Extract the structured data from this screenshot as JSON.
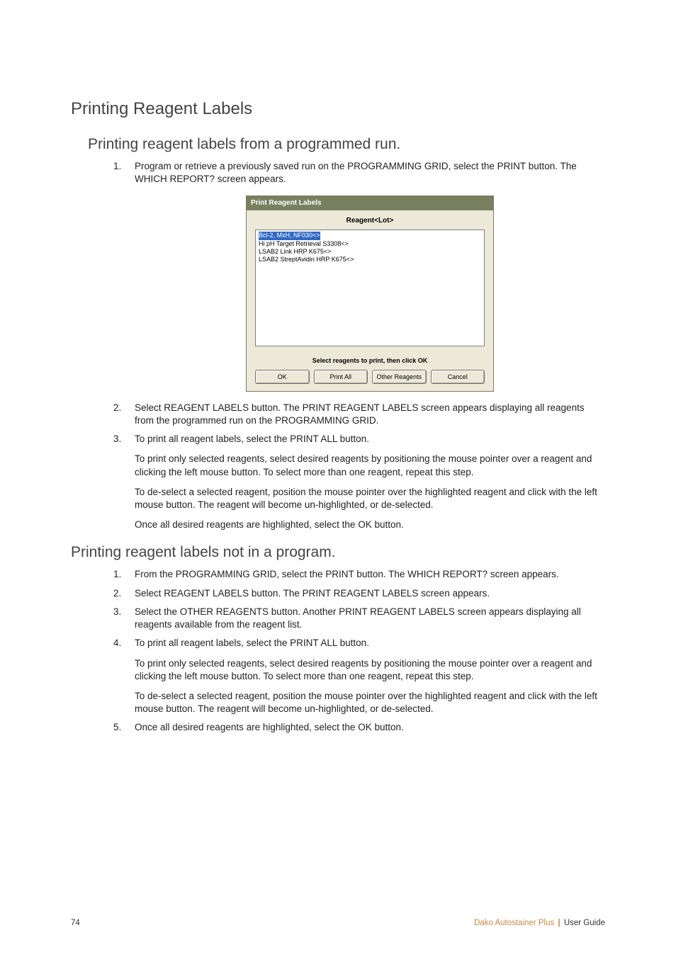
{
  "heading": "Printing Reagent Labels",
  "section1": {
    "title": "Printing reagent labels from a programmed run.",
    "items": [
      {
        "text": "Program or retrieve a previously saved run on the PROGRAMMING GRID, select the PRINT button. The WHICH REPORT? screen appears."
      },
      {
        "text": "Select REAGENT LABELS button. The PRINT REAGENT LABELS screen appears displaying all reagents from the programmed run on the PROGRAMMING GRID."
      },
      {
        "text": "To print all reagent labels, select the PRINT ALL button.",
        "paras": [
          "To print only selected reagents, select desired reagents by positioning the mouse pointer over a reagent and clicking the left mouse button. To select more than one reagent, repeat this step.",
          "To de-select a selected reagent, position the mouse pointer over the highlighted reagent and click with the left mouse button.  The reagent will become un-highlighted, or de-selected.",
          "Once all desired reagents are highlighted, select the OK button."
        ]
      }
    ]
  },
  "dialog": {
    "title": "Print Reagent Labels",
    "header": "Reagent<Lot>",
    "list": [
      "Bcl-2, MxH, NF030<>",
      "Hi pH Target Retrieval S3308<>",
      "LSAB2 Link HRP K675<>",
      "LSAB2 StreptAvidin HRP K675<>"
    ],
    "instruction": "Select reagents to print, then click OK",
    "buttons": {
      "ok": "OK",
      "print_all": "Print All",
      "other": "Other Reagents",
      "cancel": "Cancel"
    }
  },
  "section2": {
    "title": "Printing reagent labels not in a program.",
    "items": [
      {
        "text": "From the PROGRAMMING GRID, select the PRINT button. The WHICH REPORT? screen appears."
      },
      {
        "text": "Select REAGENT LABELS button. The PRINT REAGENT LABELS screen appears."
      },
      {
        "text": "Select the OTHER REAGENTS button. Another PRINT REAGENT LABELS screen appears displaying all reagents available from the reagent list."
      },
      {
        "text": "To print all reagent labels, select the PRINT ALL button.",
        "paras": [
          "To print only selected reagents, select desired reagents by positioning the mouse pointer over a reagent and clicking the left mouse button. To select more than one reagent, repeat this step.",
          "To de-select a selected reagent, position the mouse pointer over the highlighted reagent and click with the left mouse button. The reagent will become un-highlighted, or de-selected."
        ]
      },
      {
        "text": "Once all desired reagents are highlighted, select the OK button."
      }
    ]
  },
  "footer": {
    "page": "74",
    "brand": "Dako Autostainer Plus",
    "suffix": "User Guide"
  }
}
